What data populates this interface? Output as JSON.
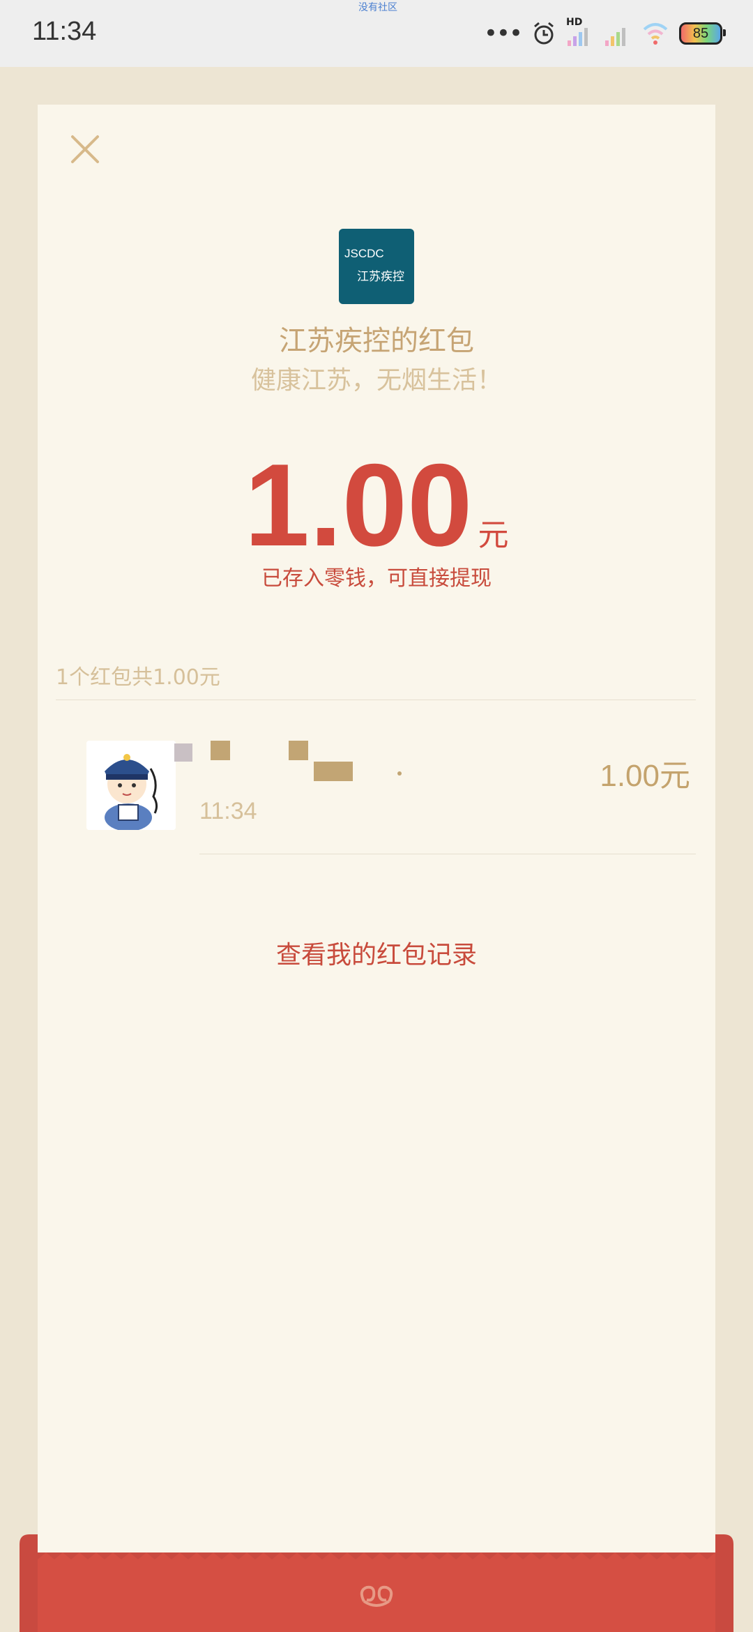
{
  "status_bar": {
    "time": "11:34",
    "top_label": "没有社区",
    "hd_label": "HD",
    "battery_level": "85"
  },
  "packet": {
    "sender_title": "江苏疾控的红包",
    "slogan": "健康江苏，无烟生活！",
    "logo_line1": "JSCDC",
    "logo_line2": "江苏疾控",
    "amount": "1.00",
    "amount_unit": "元",
    "deposit_note": "已存入零钱，可直接提现",
    "summary": "1个红包共1.00元"
  },
  "records": [
    {
      "time": "11:34",
      "amount": "1.00元"
    }
  ],
  "history_link": "查看我的红包记录",
  "colors": {
    "accent_red": "#d24a3e",
    "gold": "#c6a474",
    "card_bg": "#faf6eb",
    "page_bg": "#ede5d3",
    "logo_bg": "#0f5f74"
  }
}
